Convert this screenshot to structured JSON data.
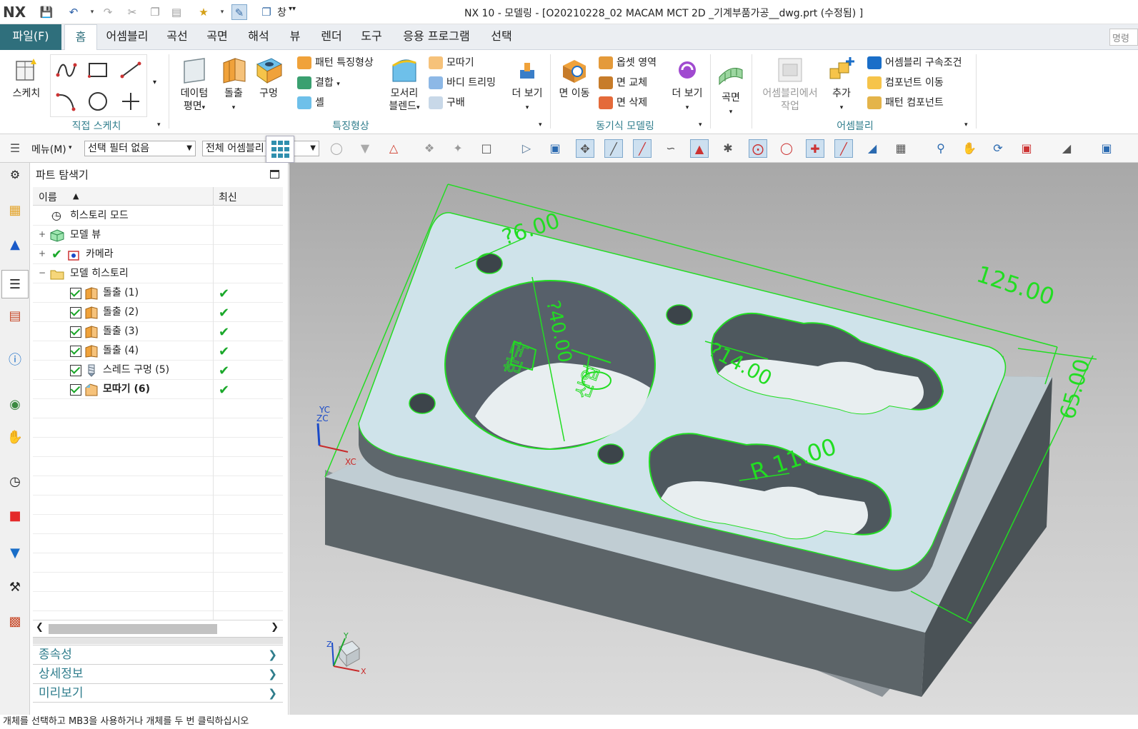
{
  "title": {
    "logo": "NX",
    "window": "NX 10 - 모델링 - [O20210228_02 MACAM MCT 2D _기계부품가공__dwg.prt (수정됨) ]",
    "window_menu": "창"
  },
  "menu_tabs": [
    "파일(F)",
    "홈",
    "어셈블리",
    "곡선",
    "곡면",
    "해석",
    "뷰",
    "렌더",
    "도구",
    "응용 프로그램",
    "선택"
  ],
  "command_search_placeholder": "명령",
  "ribbon": {
    "direct_sketch": {
      "label": "직접 스케치",
      "sketch": "스케치"
    },
    "feature": {
      "label": "특징형상",
      "datum_line1": "데이텀",
      "datum_line2": "평면",
      "extrude": "돌출",
      "hole": "구멍",
      "pattern_feature": "패턴 특징형상",
      "unite": "결합",
      "shell": "셸",
      "edge_blend_line1": "모서리",
      "edge_blend_line2": "블렌드",
      "chamfer": "모따기",
      "trim_body": "바디 트리밍",
      "draft": "구배",
      "more": "더 보기"
    },
    "synchronous": {
      "label": "동기식 모델링",
      "move_face": "면 이동",
      "offset_region": "옵셋 영역",
      "replace_face": "면 교체",
      "delete_face": "면 삭제",
      "more": "더 보기"
    },
    "surface": {
      "label": "곡면",
      "surface": "곡면"
    },
    "assembly": {
      "label": "어셈블리",
      "wave_line1": "어셈블리에서",
      "wave_line2": "작업",
      "add": "추가",
      "constraints": "어셈블리 구속조건",
      "move_component": "컴포넌트 이동",
      "pattern_component": "패턴 컴포넌트"
    }
  },
  "toolbar2": {
    "menu": "메뉴(M)",
    "type_filter": "선택 필터 없음",
    "scope": "전체 어셈블리"
  },
  "navigator": {
    "title": "파트 탐색기",
    "col_name": "이름",
    "col_latest": "최신",
    "rows": [
      {
        "label": "히스토리 모드"
      },
      {
        "label": "모델 뷰"
      },
      {
        "label": "카메라"
      },
      {
        "label": "모델 히스토리"
      },
      {
        "label": "돌출 (1)"
      },
      {
        "label": "돌출 (2)"
      },
      {
        "label": "돌출 (3)"
      },
      {
        "label": "돌출 (4)"
      },
      {
        "label": "스레드 구멍 (5)"
      },
      {
        "label": "모따기 (6)"
      }
    ],
    "panels": [
      "종속성",
      "상세정보",
      "미리보기"
    ]
  },
  "viewport": {
    "dim_length": "125.00",
    "dim_width": "65.00",
    "dim_small_hole": "?6.00",
    "dim_big_hole": "?40.00",
    "dim_slot": "?14.00",
    "dim_radius": "R 11.00",
    "engraving": "한국",
    "engraving_char2": "산업",
    "axis_yc": "YC",
    "axis_zc": "ZC",
    "axis_xc": "XC",
    "triad_z": "Z",
    "triad_y": "Y",
    "triad_x": "X"
  },
  "status": "개체를 선택하고 MB3을 사용하거나 개체를 두 번 클릭하십시오",
  "colors": {
    "accent": "#2f6f7c",
    "group_label": "#2f7d8c",
    "check_green": "#1aa82a",
    "dimension_green": "#22dd22",
    "part_top": "#cfe3ea",
    "part_side": "#5c6468"
  }
}
